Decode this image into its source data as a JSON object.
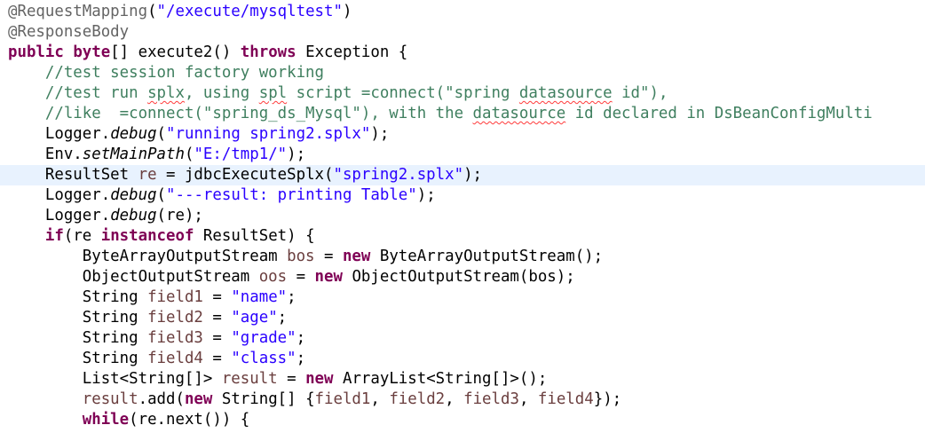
{
  "editor": {
    "current_line_color": "#e8f2fe",
    "colors": {
      "keyword": "#7f0055",
      "comment": "#3f7f5f",
      "string": "#2a00ff",
      "annotation": "#646464",
      "field": "#0000c0",
      "local": "#6a3e3e",
      "spell_error": "#ff3b3b"
    },
    "lines": [
      {
        "indent": "",
        "tokens": [
          {
            "t": "annotation",
            "v": "@RequestMapping"
          },
          {
            "t": "plain",
            "v": "("
          },
          {
            "t": "string",
            "v": "\"/execute/mysqltest\""
          },
          {
            "t": "plain",
            "v": ")"
          }
        ]
      },
      {
        "indent": "",
        "tokens": [
          {
            "t": "annotation",
            "v": "@ResponseBody"
          }
        ]
      },
      {
        "indent": "",
        "tokens": [
          {
            "t": "keyword",
            "v": "public"
          },
          {
            "t": "plain",
            "v": " "
          },
          {
            "t": "keyword",
            "v": "byte"
          },
          {
            "t": "plain",
            "v": "[] execute2() "
          },
          {
            "t": "keyword",
            "v": "throws"
          },
          {
            "t": "plain",
            "v": " Exception {"
          }
        ]
      },
      {
        "indent": "    ",
        "tokens": [
          {
            "t": "comment",
            "v": "//test session factory working"
          }
        ]
      },
      {
        "indent": "    ",
        "tokens": [
          {
            "t": "comment",
            "v": "//test run "
          },
          {
            "t": "comment",
            "v": "splx",
            "sq": true
          },
          {
            "t": "comment",
            "v": ", using "
          },
          {
            "t": "comment",
            "v": "spl",
            "sq": true
          },
          {
            "t": "comment",
            "v": " script =connect(\"spring "
          },
          {
            "t": "comment",
            "v": "datasource",
            "sq": true
          },
          {
            "t": "comment",
            "v": " id\"),"
          }
        ]
      },
      {
        "indent": "    ",
        "tokens": [
          {
            "t": "comment",
            "v": "//like  =connect(\"spring_ds_Mysql\"), with the "
          },
          {
            "t": "comment",
            "v": "datasource",
            "sq": true
          },
          {
            "t": "comment",
            "v": " id declared in DsBeanConfigMulti"
          }
        ]
      },
      {
        "indent": "    ",
        "tokens": [
          {
            "t": "plain",
            "v": "Logger."
          },
          {
            "t": "static",
            "v": "debug"
          },
          {
            "t": "plain",
            "v": "("
          },
          {
            "t": "string",
            "v": "\"running spring2.splx\""
          },
          {
            "t": "plain",
            "v": ");"
          }
        ]
      },
      {
        "indent": "    ",
        "tokens": [
          {
            "t": "plain",
            "v": "Env."
          },
          {
            "t": "static",
            "v": "setMainPath"
          },
          {
            "t": "plain",
            "v": "("
          },
          {
            "t": "string",
            "v": "\"E:/tmp1/\""
          },
          {
            "t": "plain",
            "v": ");"
          }
        ]
      },
      {
        "indent": "    ",
        "current": true,
        "tokens": [
          {
            "t": "plain",
            "v": "ResultSet "
          },
          {
            "t": "local",
            "v": "re"
          },
          {
            "t": "plain",
            "v": " = jdbcExecuteSplx("
          },
          {
            "t": "string",
            "v": "\"spring2.splx\""
          },
          {
            "t": "plain",
            "v": ");"
          }
        ]
      },
      {
        "indent": "    ",
        "tokens": [
          {
            "t": "plain",
            "v": "Logger."
          },
          {
            "t": "static",
            "v": "debug"
          },
          {
            "t": "plain",
            "v": "("
          },
          {
            "t": "string",
            "v": "\"---result: printing Table\""
          },
          {
            "t": "plain",
            "v": ");"
          }
        ]
      },
      {
        "indent": "    ",
        "tokens": [
          {
            "t": "plain",
            "v": "Logger."
          },
          {
            "t": "static",
            "v": "debug"
          },
          {
            "t": "plain",
            "v": "(re);"
          }
        ]
      },
      {
        "indent": "    ",
        "tokens": [
          {
            "t": "keyword",
            "v": "if"
          },
          {
            "t": "plain",
            "v": "(re "
          },
          {
            "t": "keyword",
            "v": "instanceof"
          },
          {
            "t": "plain",
            "v": " ResultSet) {"
          }
        ]
      },
      {
        "indent": "        ",
        "tokens": [
          {
            "t": "plain",
            "v": "ByteArrayOutputStream "
          },
          {
            "t": "local",
            "v": "bos"
          },
          {
            "t": "plain",
            "v": " = "
          },
          {
            "t": "keyword",
            "v": "new"
          },
          {
            "t": "plain",
            "v": " ByteArrayOutputStream();"
          }
        ]
      },
      {
        "indent": "        ",
        "tokens": [
          {
            "t": "plain",
            "v": "ObjectOutputStream "
          },
          {
            "t": "local",
            "v": "oos"
          },
          {
            "t": "plain",
            "v": " = "
          },
          {
            "t": "keyword",
            "v": "new"
          },
          {
            "t": "plain",
            "v": " ObjectOutputStream(bos);"
          }
        ]
      },
      {
        "indent": "        ",
        "tokens": [
          {
            "t": "plain",
            "v": "String "
          },
          {
            "t": "local",
            "v": "field1"
          },
          {
            "t": "plain",
            "v": " = "
          },
          {
            "t": "string",
            "v": "\"name\""
          },
          {
            "t": "plain",
            "v": ";"
          }
        ]
      },
      {
        "indent": "        ",
        "tokens": [
          {
            "t": "plain",
            "v": "String "
          },
          {
            "t": "local",
            "v": "field2"
          },
          {
            "t": "plain",
            "v": " = "
          },
          {
            "t": "string",
            "v": "\"age\""
          },
          {
            "t": "plain",
            "v": ";"
          }
        ]
      },
      {
        "indent": "        ",
        "tokens": [
          {
            "t": "plain",
            "v": "String "
          },
          {
            "t": "local",
            "v": "field3"
          },
          {
            "t": "plain",
            "v": " = "
          },
          {
            "t": "string",
            "v": "\"grade\""
          },
          {
            "t": "plain",
            "v": ";"
          }
        ]
      },
      {
        "indent": "        ",
        "tokens": [
          {
            "t": "plain",
            "v": "String "
          },
          {
            "t": "local",
            "v": "field4"
          },
          {
            "t": "plain",
            "v": " = "
          },
          {
            "t": "string",
            "v": "\"class\""
          },
          {
            "t": "plain",
            "v": ";"
          }
        ]
      },
      {
        "indent": "        ",
        "tokens": [
          {
            "t": "plain",
            "v": "List<String[]> "
          },
          {
            "t": "local",
            "v": "result"
          },
          {
            "t": "plain",
            "v": " = "
          },
          {
            "t": "keyword",
            "v": "new"
          },
          {
            "t": "plain",
            "v": " ArrayList<String[]>();"
          }
        ]
      },
      {
        "indent": "        ",
        "tokens": [
          {
            "t": "local",
            "v": "result"
          },
          {
            "t": "plain",
            "v": ".add("
          },
          {
            "t": "keyword",
            "v": "new"
          },
          {
            "t": "plain",
            "v": " String[] {"
          },
          {
            "t": "local",
            "v": "field1"
          },
          {
            "t": "plain",
            "v": ", "
          },
          {
            "t": "local",
            "v": "field2"
          },
          {
            "t": "plain",
            "v": ", "
          },
          {
            "t": "local",
            "v": "field3"
          },
          {
            "t": "plain",
            "v": ", "
          },
          {
            "t": "local",
            "v": "field4"
          },
          {
            "t": "plain",
            "v": "});"
          }
        ]
      },
      {
        "indent": "        ",
        "tokens": [
          {
            "t": "keyword",
            "v": "while"
          },
          {
            "t": "plain",
            "v": "(re.next()) {"
          }
        ]
      }
    ]
  }
}
